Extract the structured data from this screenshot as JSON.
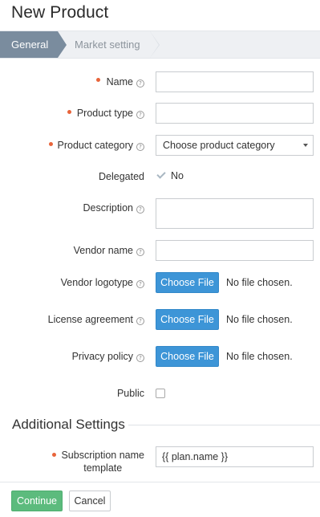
{
  "page": {
    "title": "New Product"
  },
  "wizard": {
    "steps": [
      {
        "label": "General",
        "active": true
      },
      {
        "label": "Market setting",
        "active": false
      }
    ]
  },
  "form": {
    "name": {
      "label": "Name",
      "value": ""
    },
    "product_type": {
      "label": "Product type",
      "value": ""
    },
    "product_category": {
      "label": "Product category",
      "selected": "Choose product category"
    },
    "delegated": {
      "label": "Delegated",
      "value": "No"
    },
    "description": {
      "label": "Description",
      "value": ""
    },
    "vendor_name": {
      "label": "Vendor name",
      "value": ""
    },
    "vendor_logotype": {
      "label": "Vendor logotype",
      "button": "Choose File",
      "status": "No file chosen."
    },
    "license_agreement": {
      "label": "License agreement",
      "button": "Choose File",
      "status": "No file chosen."
    },
    "privacy_policy": {
      "label": "Privacy policy",
      "button": "Choose File",
      "status": "No file chosen."
    },
    "public": {
      "label": "Public",
      "checked": false
    }
  },
  "additional": {
    "title": "Additional Settings",
    "subscription_name": {
      "label_line1": "Subscription name",
      "label_line2": "template",
      "value": "{{ plan.name }}"
    }
  },
  "footer": {
    "continue": "Continue",
    "cancel": "Cancel"
  },
  "colors": {
    "accent": "#3d95d7",
    "required": "#e8643a",
    "continue": "#5cbb7d",
    "wizard_active": "#7a8c9e"
  }
}
